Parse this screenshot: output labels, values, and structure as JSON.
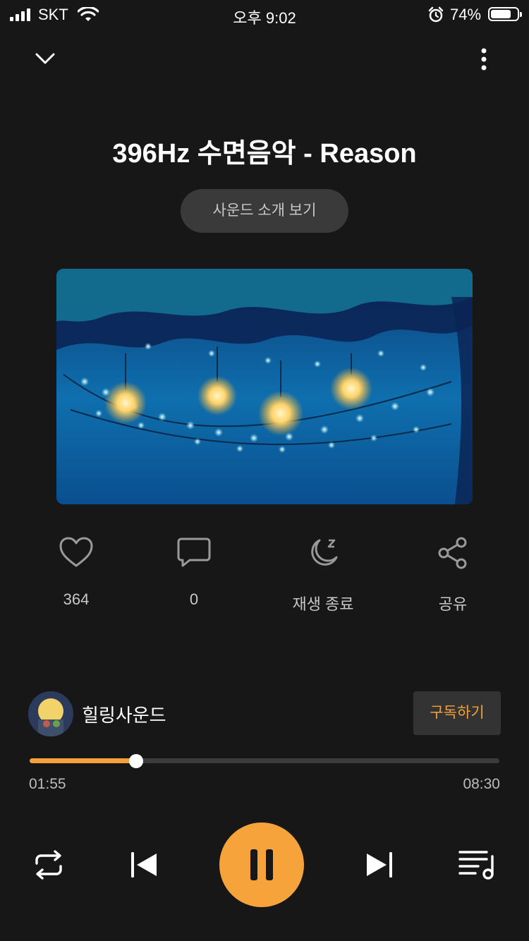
{
  "status_bar": {
    "carrier": "SKT",
    "time": "오후 9:02",
    "battery": "74%"
  },
  "track": {
    "title": "396Hz 수면음악 - Reason"
  },
  "intro_button": "사운드 소개 보기",
  "actions": {
    "like_count": "364",
    "comment_count": "0",
    "sleep_timer": "재생 종료",
    "share": "공유"
  },
  "channel": {
    "name": "힐링사운드",
    "subscribe_label": "구독하기"
  },
  "progress": {
    "elapsed": "01:55",
    "total": "08:30",
    "fraction": 0.226
  },
  "colors": {
    "accent": "#f7a33c",
    "background": "#171717"
  },
  "icons": [
    "chevron-down-icon",
    "more-vertical-icon",
    "heart-icon",
    "comment-icon",
    "moon-sleep-icon",
    "share-icon",
    "repeat-icon",
    "previous-icon",
    "pause-icon",
    "next-icon",
    "playlist-icon"
  ]
}
